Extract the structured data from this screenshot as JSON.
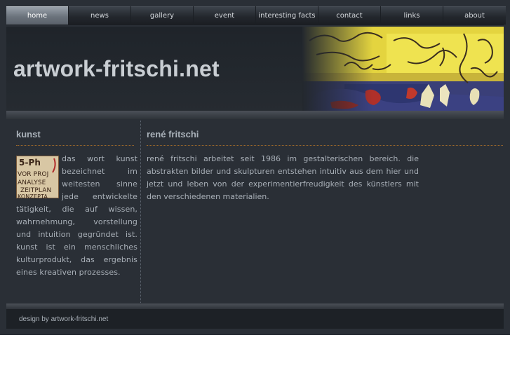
{
  "nav": {
    "items": [
      "home",
      "news",
      "gallery",
      "event",
      "interesting facts",
      "contact",
      "links",
      "about"
    ],
    "active": "home"
  },
  "banner": {
    "title": "artwork-fritschi.net",
    "art_icon": "abstract-painting-image"
  },
  "left": {
    "heading": "kunst",
    "image_icon": "handwritten-notes-image",
    "text": "das wort kunst bezeichnet im weitesten sinne jede entwickelte tätigkeit, die auf wissen, wahrnehmung, vorstellung und intuition gegründet ist. kunst ist ein menschliches kulturprodukt, das ergebnis eines kreativen prozesses."
  },
  "right": {
    "heading": "rené fritschi",
    "text": "rené fritschi arbeitet seit 1986 im gestalterischen bereich. die abstrakten bilder und skulpturen entstehen intuitiv aus dem hier und jetzt und leben von der experimentierfreudigkeit des künstlers mit den verschiedenen materialien."
  },
  "footer": {
    "text": "design by artwork-fritschi.net"
  },
  "colors": {
    "background": "#2a2f36",
    "accent_rule": "#a06a2a",
    "text": "#a9b0b8"
  }
}
